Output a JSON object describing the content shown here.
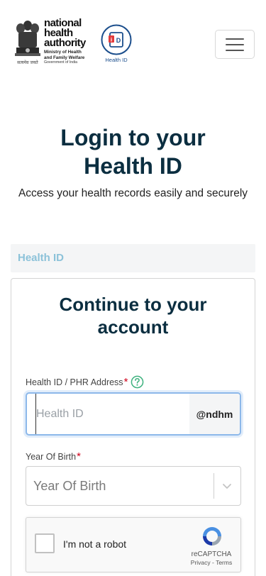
{
  "header": {
    "nha_logo": {
      "line1": "national",
      "line2": "health",
      "line3": "authority",
      "ministry_line1": "Ministry of Health",
      "ministry_line2": "and Family Welfare",
      "ministry_line3": "Government of India",
      "emblem_caption": "सत्यमेव जयते"
    },
    "health_id_logo_label": "Health ID",
    "menu_icon": "hamburger-menu-icon"
  },
  "page": {
    "title_line1": "Login to your",
    "title_line2": "Health ID",
    "subtitle": "Access your health records easily and securely"
  },
  "tab": {
    "label": "Health ID"
  },
  "card": {
    "title_line1": "Continue to your",
    "title_line2": "account",
    "health_id_field": {
      "label": "Health ID / PHR Address",
      "required_mark": "*",
      "placeholder": "Health ID",
      "value": "",
      "suffix": "@ndhm",
      "help_icon": "question-circle-icon"
    },
    "year_of_birth_field": {
      "label": "Year Of Birth",
      "required_mark": "*",
      "placeholder": "Year Of Birth",
      "chevron_icon": "chevron-down-icon"
    },
    "recaptcha": {
      "label": "I'm not a robot",
      "brand": "reCAPTCHA",
      "links": "Privacy - Terms",
      "checked": false
    }
  },
  "colors": {
    "title": "#0b2e40",
    "tab_label": "#8cc2d9",
    "required": "#d0021b",
    "help_icon": "#3fb27f",
    "input_focus_border": "#8cb8ea"
  }
}
